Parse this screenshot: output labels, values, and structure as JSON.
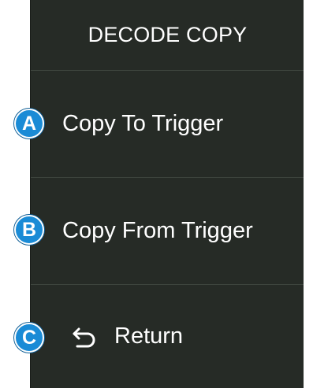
{
  "menu": {
    "title": "DECODE COPY",
    "items": [
      {
        "label": "Copy To Trigger",
        "badge": "A"
      },
      {
        "label": "Copy From Trigger",
        "badge": "B"
      },
      {
        "label": "Return",
        "badge": "C",
        "icon": "return-arrow-icon"
      }
    ]
  },
  "colors": {
    "panel_background": "#262b26",
    "text": "#ffffff",
    "badge": "#1a8bd6"
  }
}
